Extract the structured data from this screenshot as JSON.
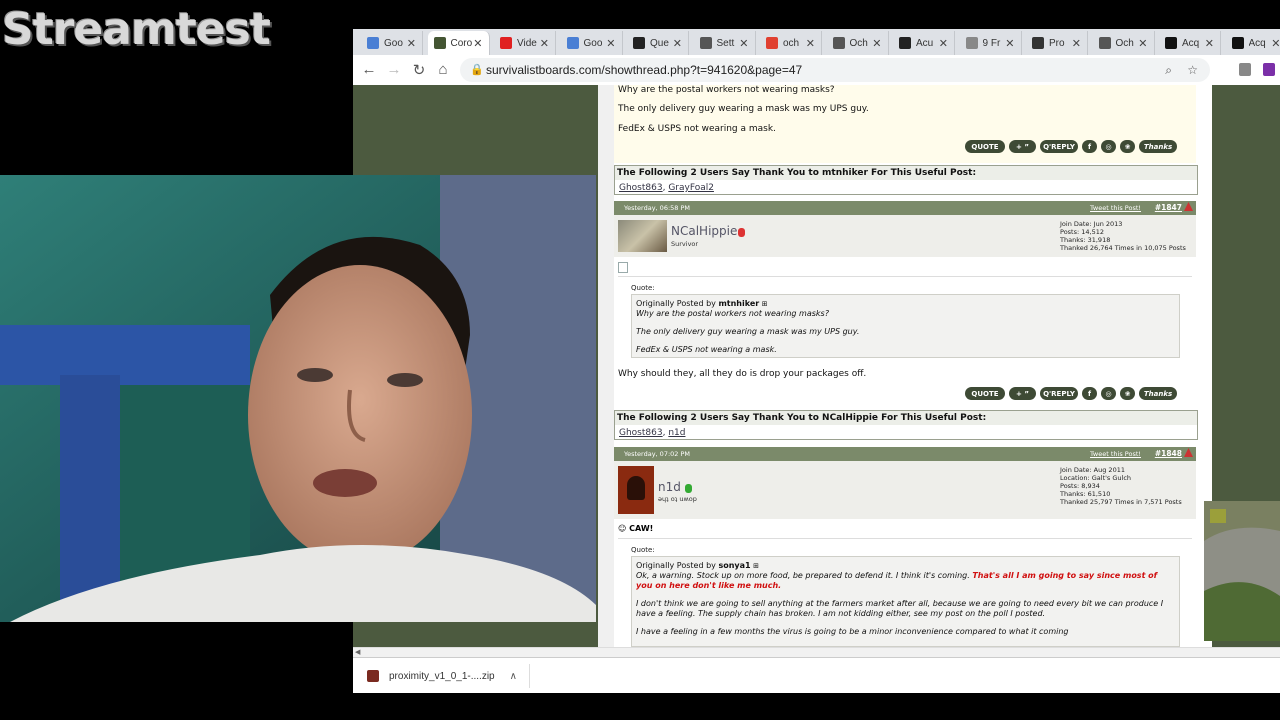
{
  "overlay": {
    "stream_title": "Streamtest"
  },
  "browser": {
    "tabs": [
      {
        "label": "Goo",
        "icon": "google-docs-icon",
        "color": "#4a7fd4"
      },
      {
        "label": "Coro",
        "icon": "site-favicon-icon",
        "color": "#445533",
        "active": true
      },
      {
        "label": "Vide",
        "icon": "youtube-icon",
        "color": "#e02020"
      },
      {
        "label": "Goo",
        "icon": "google-docs-icon",
        "color": "#4a7fd4"
      },
      {
        "label": "Que",
        "icon": "question-icon",
        "color": "#222222"
      },
      {
        "label": "Sett",
        "icon": "gear-icon",
        "color": "#555555"
      },
      {
        "label": "och",
        "icon": "google-icon",
        "color": "#e04030"
      },
      {
        "label": "Och",
        "icon": "pencil-icon",
        "color": "#555555"
      },
      {
        "label": "Acu",
        "icon": "wikipedia-icon",
        "color": "#222222"
      },
      {
        "label": "9 Fr",
        "icon": "web-icon",
        "color": "#888888"
      },
      {
        "label": "Pro",
        "icon": "puzzle-icon",
        "color": "#333333"
      },
      {
        "label": "Och",
        "icon": "globe-icon",
        "color": "#555555"
      },
      {
        "label": "Acq",
        "icon": "dark-site-icon",
        "color": "#111111"
      },
      {
        "label": "Acq",
        "icon": "dark-site-icon",
        "color": "#111111"
      }
    ],
    "url": "survivalistboards.com/showthread.php?t=941620&page=47"
  },
  "post1": {
    "lines": [
      "Why are the postal workers not wearing masks?",
      "The only delivery guy wearing a mask was my UPS guy.",
      "FedEx & USPS not wearing a mask."
    ]
  },
  "buttons": {
    "quote": "QUOTE",
    "multi": "+ ”",
    "qreply": "Q'REPLY",
    "thanks": "Thanks"
  },
  "thanks1": {
    "header": "The Following 2 Users Say Thank You to mtnhiker For This Useful Post:",
    "users": [
      "Ghost863",
      "GrayFoal2"
    ]
  },
  "post1847": {
    "timestamp": "Yesterday, 06:58 PM",
    "tweet": "Tweet this Post!",
    "number": "#1847",
    "username": "NCalHippie",
    "title": "Survivor",
    "stats": [
      "Join Date: Jun 2013",
      "Posts: 14,512",
      "Thanks: 31,918",
      "Thanked 26,764 Times in 10,075 Posts"
    ],
    "quote_label": "Quote:",
    "quote_author_prefix": "Originally Posted by",
    "quote_author": "mtnhiker",
    "quote_lines": [
      "Why are the postal workers not wearing masks?",
      "The only delivery guy wearing a mask was my UPS guy.",
      "FedEx & USPS not wearing a mask."
    ],
    "reply": "Why should they, all they do is drop your packages off."
  },
  "thanks2": {
    "header": "The Following 2 Users Say Thank You to NCalHippie For This Useful Post:",
    "users": [
      "Ghost863",
      "n1d"
    ]
  },
  "post1848": {
    "timestamp": "Yesterday, 07:02 PM",
    "tweet": "Tweet this Post!",
    "number": "#1848",
    "username": "n1d",
    "title": "ǝɥʇ oʇ uʍop",
    "stats": [
      "Join Date: Aug 2011",
      "Location: Galt's Gulch",
      "Posts: 8,934",
      "Thanks: 61,510",
      "Thanked 25,797 Times in 7,571 Posts"
    ],
    "post_title": "CAW!",
    "quote_label": "Quote:",
    "quote_author_prefix": "Originally Posted by",
    "quote_author": "sonya1",
    "quote_line1": "Ok, a warning. Stock up on more food, be prepared to defend it. I think it's coming.",
    "quote_line1_red": "That's all I am going to say since most of you on here don't like me much.",
    "quote_para2": "I don't think we are going to sell anything at the farmers market after all, because we are going to need every bit we can produce I have a feeling. The supply chain has broken. I am not kidding either, see my post on the poll I posted.",
    "quote_para3": "I have a feeling in a few months the virus is going to be a minor inconvenience compared to what it coming"
  },
  "download": {
    "filename": "proximity_v1_0_1-....zip"
  }
}
